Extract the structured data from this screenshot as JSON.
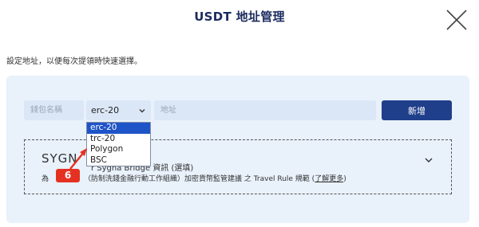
{
  "modal": {
    "title": "USDT 地址管理"
  },
  "instruction": "設定地址，以便每次提領時快速選擇。",
  "form": {
    "wallet_name_placeholder": "錢包名稱",
    "network_value": "erc-20",
    "network_options": [
      "erc-20",
      "trc-20",
      "Polygon",
      "BSC"
    ],
    "address_placeholder": "地址",
    "add_button_label": "新增"
  },
  "sygna": {
    "logo_text": "SYGN",
    "title": "r Sygna Bridge 資訊 (選填)",
    "desc_prefix": "為",
    "desc_middle": "（防制洗錢金融行動工作組織）加密貨幣監管建議 之 Travel Rule 規範 (",
    "learn_more": "了解更多",
    "desc_suffix": ")"
  },
  "annotation": {
    "step": "6"
  },
  "colors": {
    "primary": "#1f3f8a",
    "panel": "#e9f1fb",
    "badge": "#e53121",
    "selected": "#1f54c8"
  }
}
